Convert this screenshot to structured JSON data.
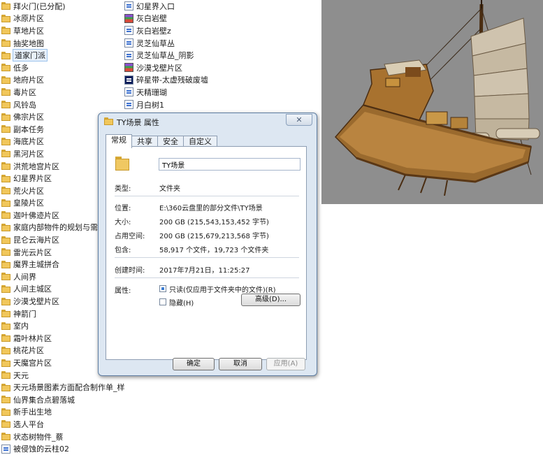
{
  "left_list": [
    {
      "label": "拜火门(已分配)",
      "icon": "folder-icon"
    },
    {
      "label": "冰原片区",
      "icon": "folder-icon"
    },
    {
      "label": "草地片区",
      "icon": "folder-icon"
    },
    {
      "label": "抽奖地图",
      "icon": "folder-icon"
    },
    {
      "label": "道家门派",
      "icon": "folder-icon",
      "selected": true
    },
    {
      "label": "低多",
      "icon": "folder-icon"
    },
    {
      "label": "地府片区",
      "icon": "folder-icon"
    },
    {
      "label": "毒片区",
      "icon": "folder-icon"
    },
    {
      "label": "风铃岛",
      "icon": "folder-icon"
    },
    {
      "label": "佛宗片区",
      "icon": "folder-icon"
    },
    {
      "label": "副本任务",
      "icon": "folder-icon"
    },
    {
      "label": "海底片区",
      "icon": "folder-icon"
    },
    {
      "label": "黑河片区",
      "icon": "folder-icon"
    },
    {
      "label": "洪荒地宫片区",
      "icon": "folder-icon"
    },
    {
      "label": "幻星界片区",
      "icon": "folder-icon"
    },
    {
      "label": "荒火片区",
      "icon": "folder-icon"
    },
    {
      "label": "皇陵片区",
      "icon": "folder-icon"
    },
    {
      "label": "迦叶佛迹片区",
      "icon": "folder-icon"
    },
    {
      "label": "家庭内部物件的规划与需求",
      "icon": "folder-icon"
    },
    {
      "label": "昆仑云海片区",
      "icon": "folder-icon"
    },
    {
      "label": "雷光云片区",
      "icon": "folder-icon"
    },
    {
      "label": "魔界主城拼合",
      "icon": "folder-icon"
    },
    {
      "label": "人间界",
      "icon": "folder-icon"
    },
    {
      "label": "人间主城区",
      "icon": "folder-icon"
    },
    {
      "label": "沙漠戈壁片区",
      "icon": "folder-icon"
    },
    {
      "label": "神箭门",
      "icon": "folder-icon"
    },
    {
      "label": "室内",
      "icon": "folder-icon"
    },
    {
      "label": "霜叶林片区",
      "icon": "folder-icon"
    },
    {
      "label": "桃花片区",
      "icon": "folder-icon"
    },
    {
      "label": "天魔宫片区",
      "icon": "folder-icon"
    },
    {
      "label": "天元",
      "icon": "folder-icon"
    },
    {
      "label": "天元场景图素方面配合制作单_样",
      "icon": "folder-icon"
    },
    {
      "label": "仙界集合点碧落城",
      "icon": "folder-icon"
    },
    {
      "label": "新手出生地",
      "icon": "folder-icon"
    },
    {
      "label": "选人平台",
      "icon": "folder-icon"
    },
    {
      "label": "状态树物件_蔡",
      "icon": "folder-icon"
    },
    {
      "label": "被侵蚀的云柱02",
      "icon": "file-icon"
    }
  ],
  "right_list": [
    {
      "label": "幻星界入口",
      "icon": "file-icon"
    },
    {
      "label": "灰白岩壁",
      "icon": "archive-icon"
    },
    {
      "label": "灰白岩壁z",
      "icon": "file-icon"
    },
    {
      "label": "灵芝仙草丛",
      "icon": "file-icon"
    },
    {
      "label": "灵芝仙草丛_阴影",
      "icon": "file-icon"
    },
    {
      "label": "沙漠戈壁片区",
      "icon": "archive-icon"
    },
    {
      "label": "碎星带-太虚残破废墟",
      "icon": "binary-icon"
    },
    {
      "label": "天精珊瑚",
      "icon": "file-icon"
    },
    {
      "label": "月白树1",
      "icon": "file-icon"
    }
  ],
  "dialog": {
    "title": "TY场景 属性",
    "close_label": "✕",
    "tabs": [
      "常规",
      "共享",
      "安全",
      "自定义"
    ],
    "folder_name": "TY场景",
    "type_label": "类型:",
    "type_value": "文件夹",
    "location_label": "位置:",
    "location_value": "E:\\360云盘里的部分文件\\TY场景",
    "size_label": "大小:",
    "size_value": "200 GB (215,543,153,452 字节)",
    "disk_size_label": "占用空间:",
    "disk_size_value": "200 GB (215,679,213,568 字节)",
    "contains_label": "包含:",
    "contains_value": "58,917 个文件，19,723 个文件夹",
    "created_label": "创建时间:",
    "created_value": "2017年7月21日，11:25:27",
    "attributes_label": "属性:",
    "readonly_label": "只读(仅应用于文件夹中的文件)(R)",
    "hidden_label": "隐藏(H)",
    "advanced_label": "高级(D)...",
    "ok_label": "确定",
    "cancel_label": "取消",
    "apply_label": "应用(A)"
  },
  "image": {
    "subject": "3D render of a Chinese junk ship",
    "background": "#8e8e8e"
  }
}
